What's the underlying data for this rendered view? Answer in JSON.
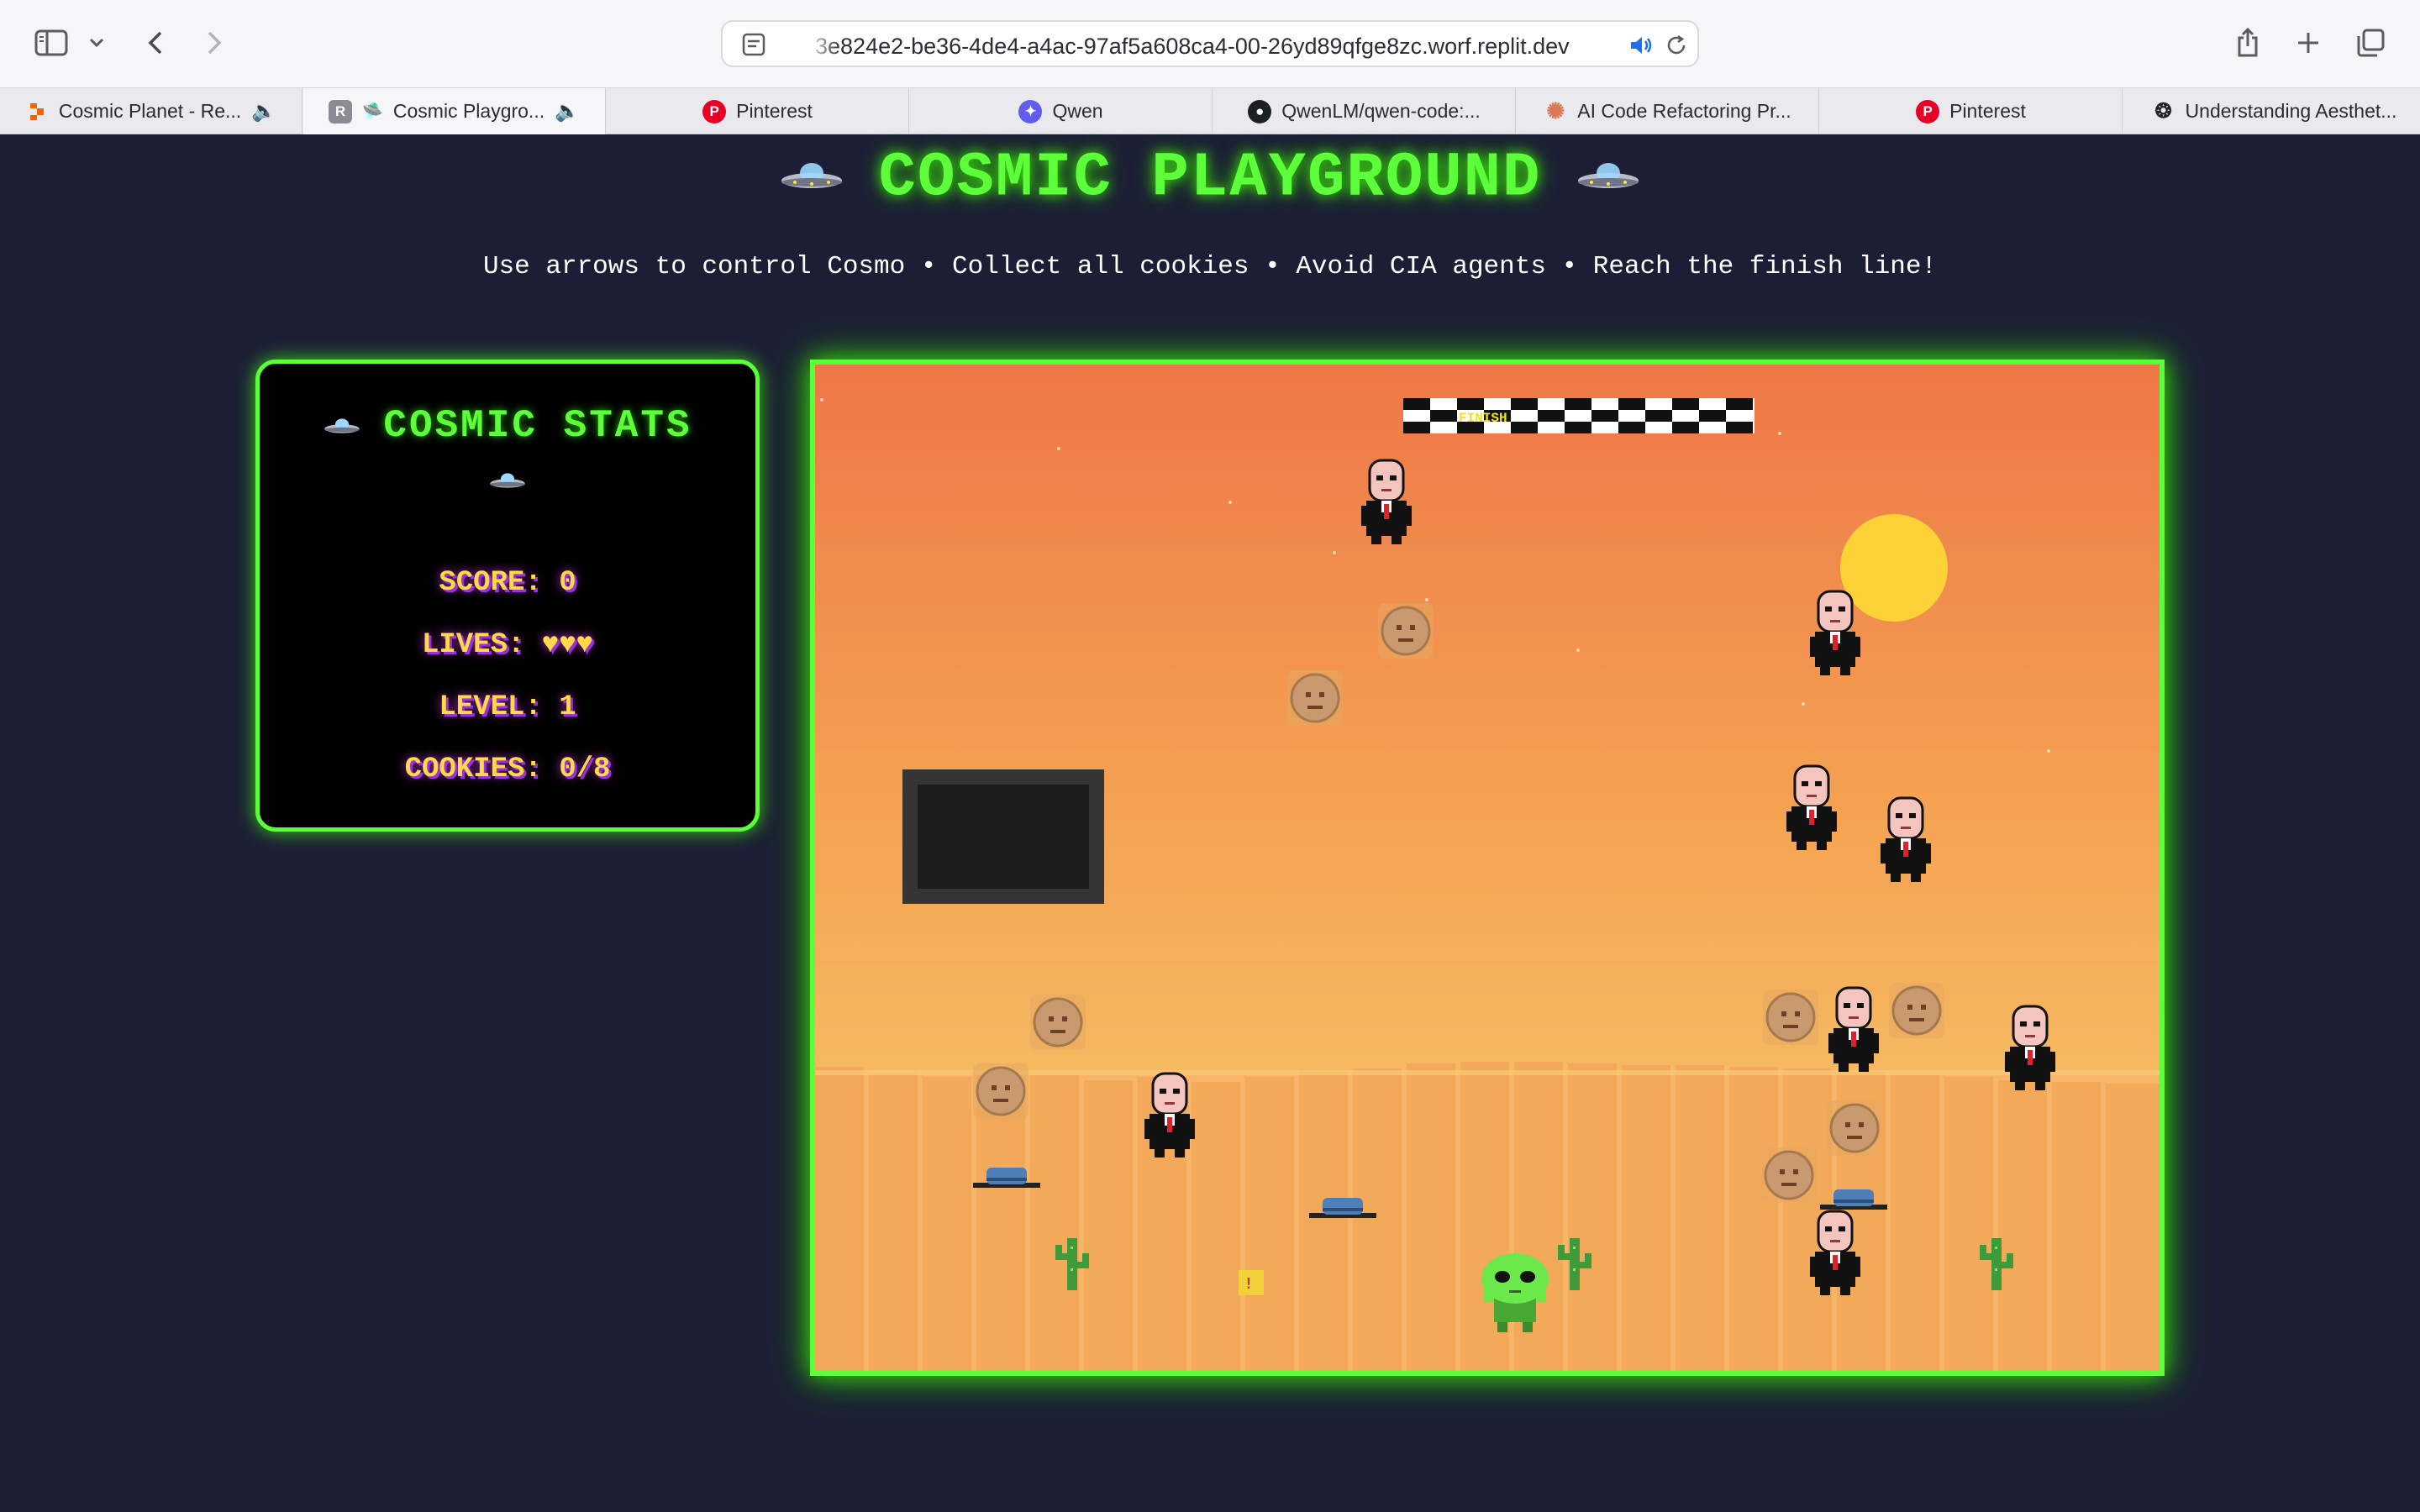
{
  "browser": {
    "url": "3e824e2-be36-4de4-a4ac-97af5a608ca4-00-26yd89qfge8zc.worf.replit.dev",
    "tabs": [
      {
        "label": "Cosmic Planet - Re...",
        "icon": "replit-orange-icon"
      },
      {
        "label": "Cosmic Playgro...",
        "icon": "replit-r-icon"
      },
      {
        "label": "Pinterest",
        "icon": "pinterest-icon"
      },
      {
        "label": "Qwen",
        "icon": "qwen-icon"
      },
      {
        "label": "QwenLM/qwen-code:...",
        "icon": "github-icon"
      },
      {
        "label": "AI Code Refactoring Pr...",
        "icon": "claude-icon"
      },
      {
        "label": "Pinterest",
        "icon": "pinterest-icon"
      },
      {
        "label": "Understanding Aesthet...",
        "icon": "openai-icon"
      }
    ],
    "active_tab": 1
  },
  "page": {
    "title": "COSMIC PLAYGROUND",
    "subtitle": "Use arrows to control Cosmo • Collect all cookies • Avoid CIA agents • Reach the finish line!"
  },
  "stats": {
    "title": "COSMIC STATS",
    "score_label": "SCORE:",
    "score": "0",
    "lives_label": "LIVES:",
    "lives": "♥♥♥",
    "level_label": "LEVEL:",
    "level": "1",
    "cookies_label": "COOKIES:",
    "cookies": "0/8"
  },
  "game": {
    "finish_label": "FINISH",
    "warning_glyph": "!",
    "colors": {
      "border": "#5cff3a",
      "sky_top": "#ee7646",
      "sky_bottom": "#f7c275",
      "sun": "#fdd237",
      "player": "#6be84a"
    }
  }
}
